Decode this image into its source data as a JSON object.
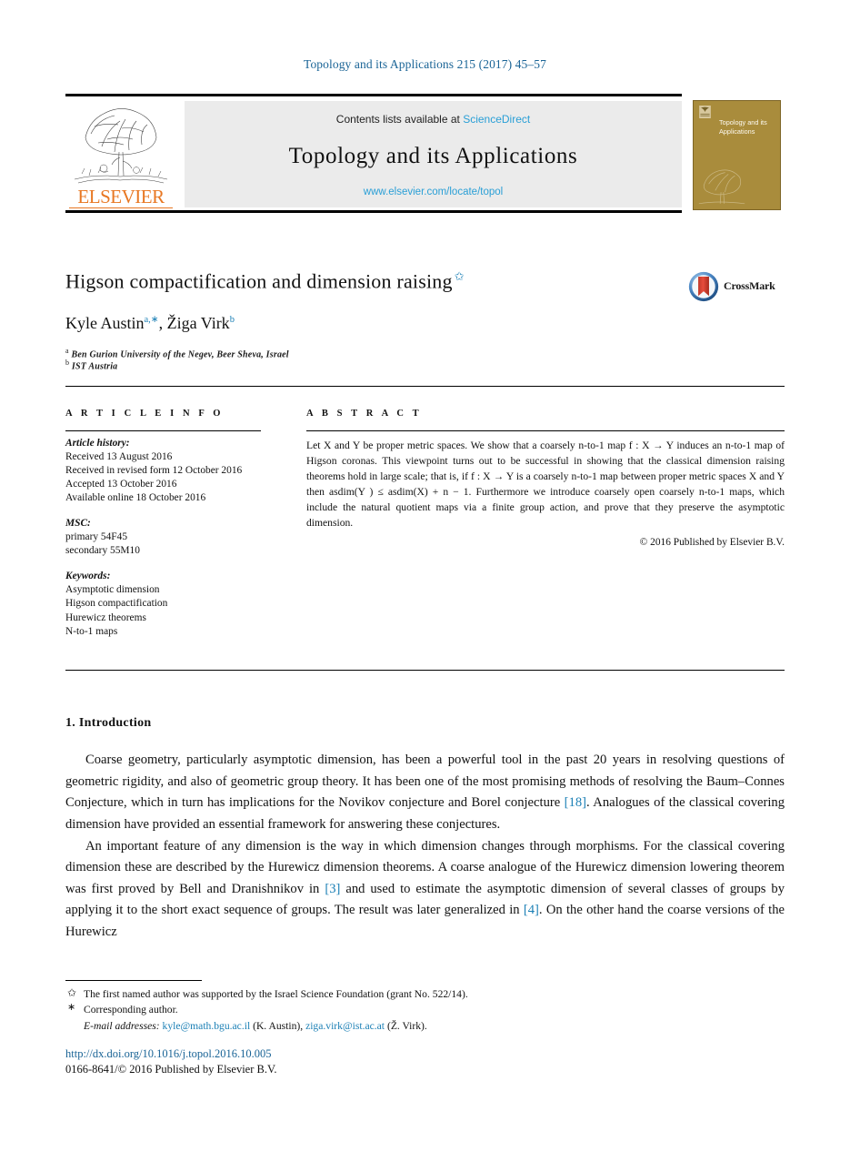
{
  "running_head": "Topology and its Applications 215 (2017) 45–57",
  "masthead": {
    "contents_prefix": "Contents lists available at ",
    "sciencedirect": "ScienceDirect",
    "journal_title": "Topology and its Applications",
    "journal_url": "www.elsevier.com/locate/topol",
    "publisher_wordmark": "ELSEVIER",
    "cover_title": "Topology and its Applications",
    "accent_link": "#2a9fd6",
    "publisher_orange": "#e87722",
    "cover_bg": "#a98c3c"
  },
  "article": {
    "title": "Higson compactification and dimension raising",
    "title_footnote_mark": "✩",
    "authors_text": "Kyle Austin",
    "author_1": "Kyle Austin",
    "author_1_marks": "a,∗",
    "author_2": "Žiga Virk",
    "author_2_marks": "b",
    "affiliation_a_mark": "a",
    "affiliation_a": "Ben Gurion University of the Negev, Beer Sheva, Israel",
    "affiliation_b_mark": "b",
    "affiliation_b": "IST Austria",
    "crossmark_label": "CrossMark"
  },
  "info": {
    "heading": "A R T I C L E  I N F O",
    "history_label": "Article history:",
    "history": [
      "Received 13 August 2016",
      "Received in revised form 12 October 2016",
      "Accepted 13 October 2016",
      "Available online 18 October 2016"
    ],
    "msc_label": "MSC:",
    "msc": [
      "primary 54F45",
      "secondary 55M10"
    ],
    "keywords_label": "Keywords:",
    "keywords": [
      "Asymptotic dimension",
      "Higson compactification",
      "Hurewicz theorems",
      "N-to-1 maps"
    ]
  },
  "abstract": {
    "heading": "A B S T R A C T",
    "text": "Let X and Y be proper metric spaces. We show that a coarsely n-to-1 map f : X → Y induces an n-to-1 map of Higson coronas. This viewpoint turns out to be successful in showing that the classical dimension raising theorems hold in large scale; that is, if f : X → Y is a coarsely n-to-1 map between proper metric spaces X and Y then asdim(Y ) ≤ asdim(X) + n − 1. Furthermore we introduce coarsely open coarsely n-to-1 maps, which include the natural quotient maps via a finite group action, and prove that they preserve the asymptotic dimension.",
    "copyright": "© 2016 Published by Elsevier B.V."
  },
  "body": {
    "section_number_title": "1. Introduction",
    "paragraph_1_a": "Coarse geometry, particularly asymptotic dimension, has been a powerful tool in the past 20 years in resolving questions of geometric rigidity, and also of geometric group theory. It has been one of the most promising methods of resolving the Baum–Connes Conjecture, which in turn has implications for the Novikov conjecture and Borel conjecture ",
    "paragraph_1_ref": "[18]",
    "paragraph_1_b": ". Analogues of the classical covering dimension have provided an essential framework for answering these conjectures.",
    "paragraph_2_a": "An important feature of any dimension is the way in which dimension changes through morphisms. For the classical covering dimension these are described by the Hurewicz dimension theorems. A coarse analogue of the Hurewicz dimension lowering theorem was first proved by Bell and Dranishnikov in ",
    "paragraph_2_ref1": "[3]",
    "paragraph_2_b": " and used to estimate the asymptotic dimension of several classes of groups by applying it to the short exact sequence of groups. The result was later generalized in ",
    "paragraph_2_ref2": "[4]",
    "paragraph_2_c": ". On the other hand the coarse versions of the Hurewicz"
  },
  "footnotes": {
    "star_mark": "✩",
    "star_note": "The first named author was supported by the Israel Science Foundation (grant No. 522/14).",
    "corr_mark": "∗",
    "corr_note": "Corresponding author.",
    "email_label": "E-mail addresses:",
    "email_1": "kyle@math.bgu.ac.il",
    "email_1_owner": "(K. Austin),",
    "email_2": "ziga.virk@ist.ac.at",
    "email_2_owner": "(Ž. Virk).",
    "doi": "http://dx.doi.org/10.1016/j.topol.2016.10.005",
    "issn_line": "0166-8641/© 2016 Published by Elsevier B.V."
  }
}
